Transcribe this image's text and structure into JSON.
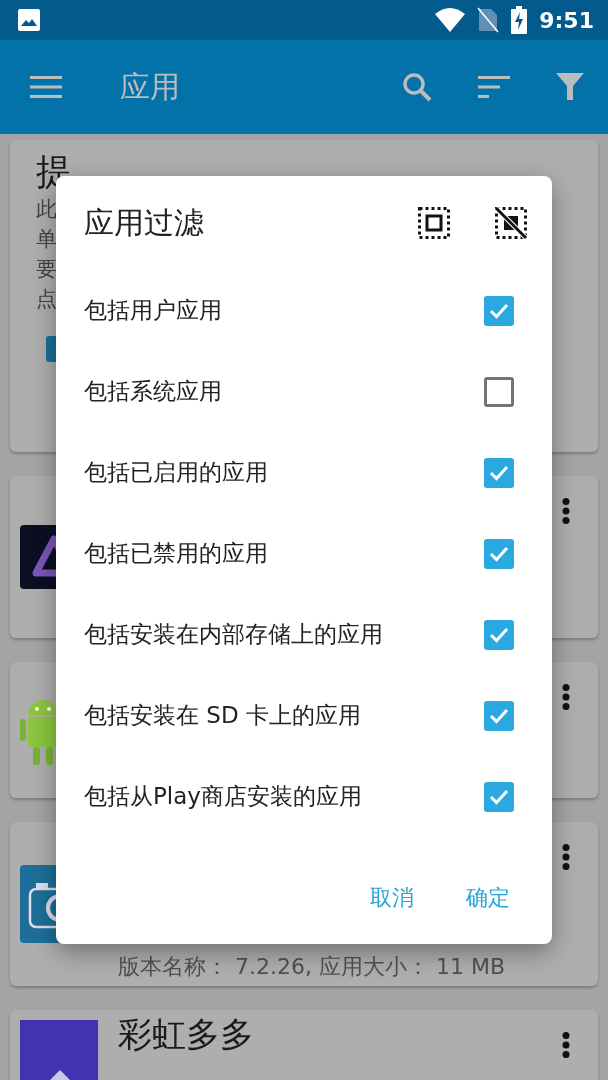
{
  "status_bar": {
    "time": "9:51"
  },
  "app_bar": {
    "title": "应用"
  },
  "cards": [
    {
      "kind": "tip",
      "title": "提",
      "lines": [
        "此",
        "单",
        "要",
        "点"
      ]
    },
    {
      "kind": "app"
    },
    {
      "kind": "app"
    },
    {
      "kind": "app",
      "lines": [
        "版本名称： 7.2.26, 应用大小： 11 MB"
      ]
    },
    {
      "kind": "app",
      "title": "彩虹多多"
    }
  ],
  "dialog": {
    "title": "应用过滤",
    "options": [
      {
        "label": "包括用户应用",
        "checked": true
      },
      {
        "label": "包括系统应用",
        "checked": false
      },
      {
        "label": "包括已启用的应用",
        "checked": true
      },
      {
        "label": "包括已禁用的应用",
        "checked": true
      },
      {
        "label": "包括安装在内部存储上的应用",
        "checked": true
      },
      {
        "label": "包括安装在 SD 卡上的应用",
        "checked": true
      },
      {
        "label": "包括从Play商店安装的应用",
        "checked": true
      }
    ],
    "buttons": [
      {
        "label": "取消"
      },
      {
        "label": "确定"
      }
    ]
  }
}
